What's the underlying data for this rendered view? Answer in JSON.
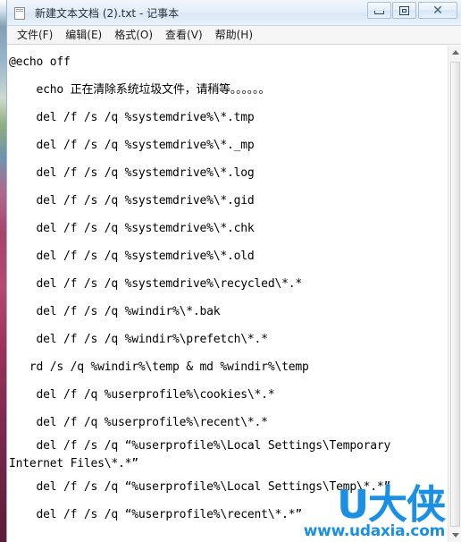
{
  "window": {
    "title": "新建文本文档 (2).txt - 记事本",
    "icon": "notepad-document-icon",
    "controls": {
      "minimize_label": "",
      "restore_label": "",
      "close_label": "✕"
    }
  },
  "menubar": {
    "items": [
      {
        "label": "文件(F)"
      },
      {
        "label": "编辑(E)"
      },
      {
        "label": "格式(O)"
      },
      {
        "label": "查看(V)"
      },
      {
        "label": "帮助(H)"
      }
    ]
  },
  "editor": {
    "lines": [
      "@echo off",
      "    echo 正在清除系统垃圾文件，请稍等。。。。。。",
      "    del /f /s /q %systemdrive%\\*.tmp",
      "    del /f /s /q %systemdrive%\\*._mp",
      "    del /f /s /q %systemdrive%\\*.log",
      "    del /f /s /q %systemdrive%\\*.gid",
      "    del /f /s /q %systemdrive%\\*.chk",
      "    del /f /s /q %systemdrive%\\*.old",
      "    del /f /s /q %systemdrive%\\recycled\\*.*",
      "    del /f /s /q %windir%\\*.bak",
      "    del /f /s /q %windir%\\prefetch\\*.*",
      "   rd /s /q %windir%\\temp & md %windir%\\temp",
      "    del /f /q %userprofile%\\cookies\\*.*",
      "    del /f /q %userprofile%\\recent\\*.*"
    ],
    "wrapped_line": {
      "first": "    del /f /s /q “%userprofile%\\Local Settings\\Temporary",
      "second": "Internet Files\\*.*”"
    },
    "lines_tail": [
      "    del /f /s /q “%userprofile%\\Local Settings\\Temp\\*.*”",
      "    del /f /s /q “%userprofile%\\recent\\*.*”"
    ]
  },
  "scrollbar": {
    "up_arrow": "scroll-up-arrow",
    "down_arrow": "scroll-down-arrow"
  },
  "watermark": {
    "logo": "U大侠",
    "url": "www.udaxia.com",
    "color": "#1a8fe3"
  }
}
